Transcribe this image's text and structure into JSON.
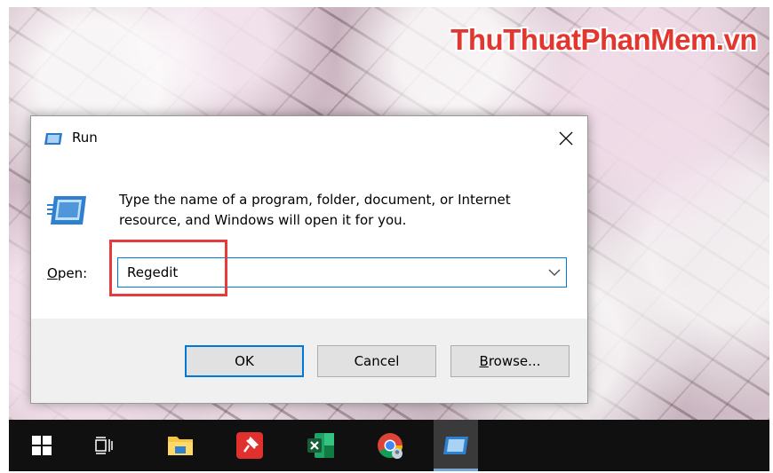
{
  "watermark": "ThuThuatPhanMem.vn",
  "dialog": {
    "title": "Run",
    "description": "Type the name of a program, folder, document, or Internet resource, and Windows will open it for you.",
    "open_label_access": "O",
    "open_label_rest": "pen:",
    "open_value": "Regedit",
    "ok_label": "OK",
    "cancel_label": "Cancel",
    "browse_label_access": "B",
    "browse_label_rest": "rowse..."
  },
  "colors": {
    "accent": "#0078d7",
    "highlight": "#e53b3b",
    "taskbar": "#101010"
  },
  "taskbar": {
    "icons": [
      "windows-start-icon",
      "task-view-icon",
      "file-explorer-icon",
      "pinned-app-icon",
      "excel-icon",
      "chrome-icon",
      "run-icon"
    ]
  }
}
